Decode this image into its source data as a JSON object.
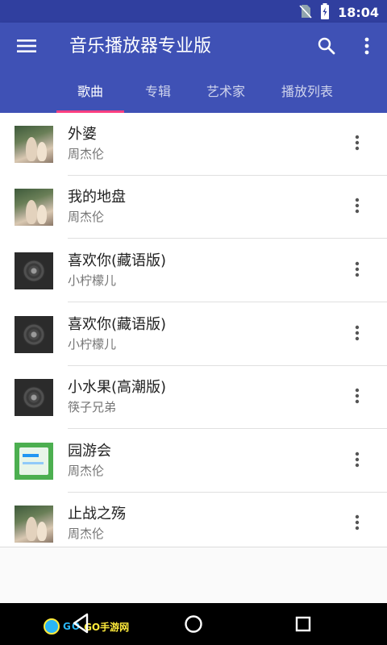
{
  "status_bar": {
    "time": "18:04"
  },
  "app_bar": {
    "title": "音乐播放器专业版"
  },
  "tabs": [
    {
      "label": "歌曲",
      "active": true
    },
    {
      "label": "专辑",
      "active": false
    },
    {
      "label": "艺术家",
      "active": false
    },
    {
      "label": "播放列表",
      "active": false
    }
  ],
  "songs": [
    {
      "title": "外婆",
      "artist": "周杰伦",
      "art": "photo"
    },
    {
      "title": "我的地盘",
      "artist": "周杰伦",
      "art": "photo"
    },
    {
      "title": "喜欢你(藏语版)",
      "artist": "小柠檬儿",
      "art": "disc"
    },
    {
      "title": "喜欢你(藏语版)",
      "artist": "小柠檬儿",
      "art": "disc"
    },
    {
      "title": "小水果(高潮版)",
      "artist": "筷子兄弟",
      "art": "disc"
    },
    {
      "title": "园游会",
      "artist": "周杰伦",
      "art": "green"
    },
    {
      "title": "止战之殇",
      "artist": "周杰伦",
      "art": "photo"
    }
  ],
  "watermark": {
    "text_a": "GO",
    "text_b": "GO手游网"
  },
  "colors": {
    "primary": "#3f51b5",
    "primary_dark": "#303f9f",
    "accent": "#ff4081"
  }
}
